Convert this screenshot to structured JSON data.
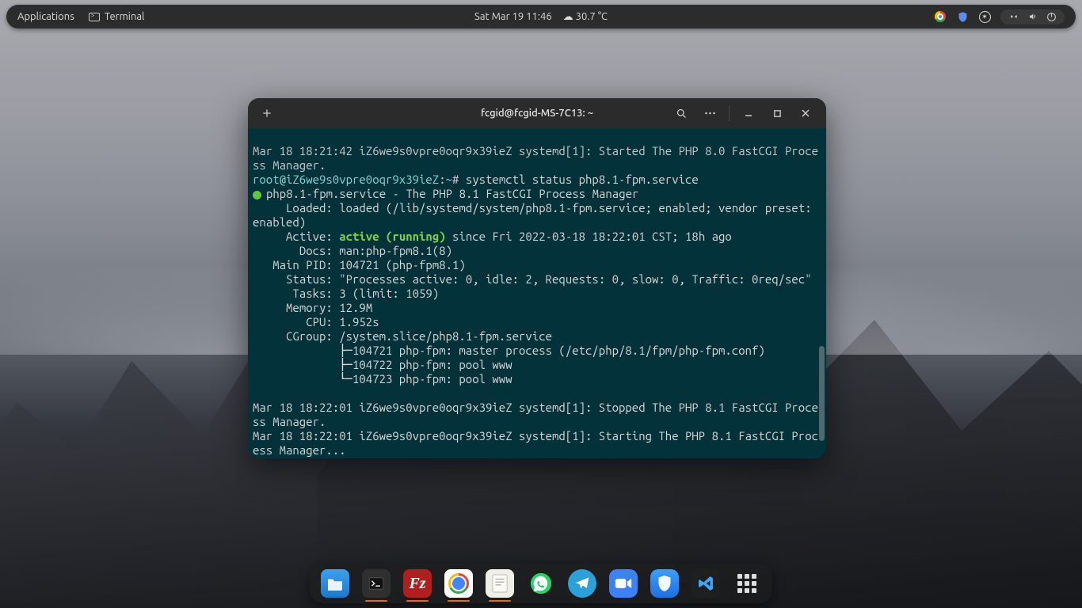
{
  "topbar": {
    "applications": "Applications",
    "terminal": "Terminal",
    "datetime": "Sat Mar 19  11:46",
    "temp": "30.7 °C"
  },
  "window": {
    "title": "fcgid@fcgid-MS-7C13: ~"
  },
  "term": {
    "l1": "Mar 18 18:21:42 iZ6we9s0vpre0oqr9x39ieZ systemd[1]: Started The PHP 8.0 FastCGI Process Manager.",
    "prompt_user": "root@iZ6we9s0vpre0oqr9x39ieZ",
    "prompt_sep": ":",
    "prompt_path": "~",
    "prompt_hash": "#",
    "cmd": "systemctl status php8.1-fpm.service",
    "svc_name": "php8.1-fpm.service - The PHP 8.1 FastCGI Process Manager",
    "loaded": "     Loaded: loaded (/lib/systemd/system/php8.1-fpm.service; enabled; vendor preset: enabled)",
    "active_lbl": "     Active: ",
    "active_val": "active (running)",
    "active_rest": " since Fri 2022-03-18 18:22:01 CST; 18h ago",
    "docs": "       Docs: man:php-fpm8.1(8)",
    "mainpid": "   Main PID: 104721 (php-fpm8.1)",
    "status": "     Status: \"Processes active: 0, idle: 2, Requests: 0, slow: 0, Traffic: 0req/sec\"",
    "tasks": "      Tasks: 3 (limit: 1059)",
    "memory": "     Memory: 12.9M",
    "cpu": "        CPU: 1.952s",
    "cgroup": "     CGroup: /system.slice/php8.1-fpm.service",
    "tree1": "             ├─104721 php-fpm: master process (/etc/php/8.1/fpm/php-fpm.conf)",
    "tree2": "             ├─104722 php-fpm: pool www",
    "tree3": "             └─104723 php-fpm: pool www",
    "log1": "Mar 18 18:22:01 iZ6we9s0vpre0oqr9x39ieZ systemd[1]: Stopped The PHP 8.1 FastCGI Process Manager.",
    "log2": "Mar 18 18:22:01 iZ6we9s0vpre0oqr9x39ieZ systemd[1]: Starting The PHP 8.1 FastCGI Process Manager..."
  },
  "dock": {
    "fz": "Fz"
  }
}
